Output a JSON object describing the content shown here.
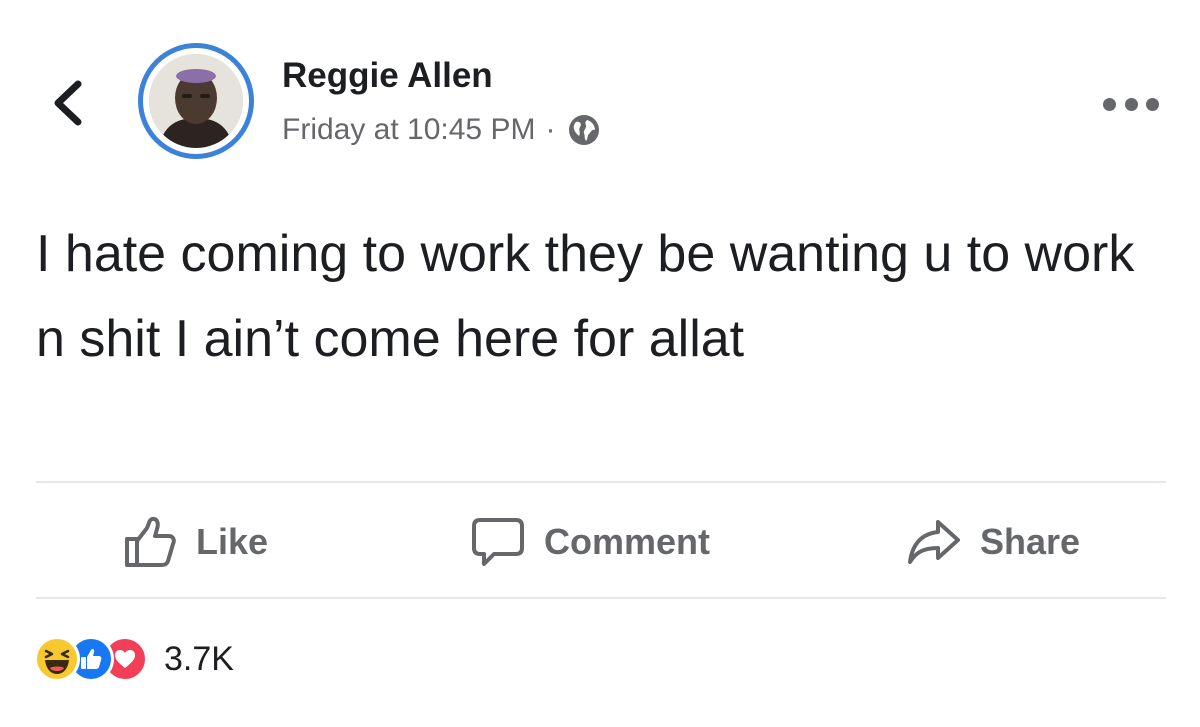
{
  "post": {
    "author": "Reggie Allen",
    "timestamp": "Friday at 10:45 PM",
    "separator": "·",
    "privacy_icon": "globe-icon",
    "text": "I hate coming to work they be wanting u to work n shit I ain’t come here for allat"
  },
  "actions": {
    "like_label": "Like",
    "comment_label": "Comment",
    "share_label": "Share"
  },
  "reactions": {
    "types": [
      "haha",
      "like",
      "love"
    ],
    "count": "3.7K"
  },
  "colors": {
    "avatar_ring": "#3b82d8",
    "secondary_text": "#65676b",
    "like_blue": "#1877f2",
    "love_red": "#f33e58",
    "haha_yellow": "#f7c92f"
  }
}
